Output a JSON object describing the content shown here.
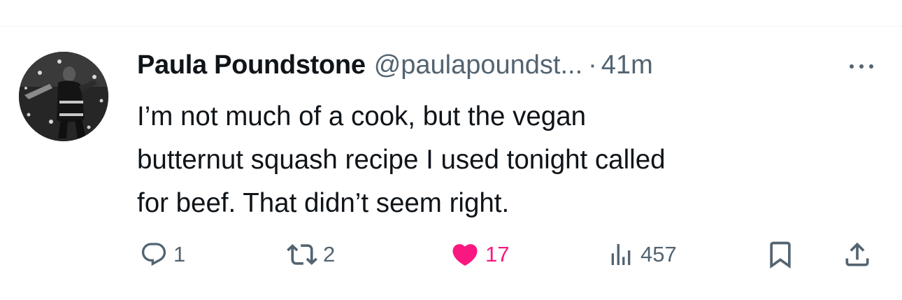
{
  "tweet": {
    "author": {
      "display_name": "Paula Poundstone",
      "handle": "@paulapoundst...",
      "separator": "·",
      "timestamp": "41m"
    },
    "text_lines": [
      "I’m not much of a cook, but the vegan",
      "butternut squash recipe I used tonight called",
      "for beef. That didn’t seem right."
    ],
    "actions": {
      "reply": {
        "icon": "reply-icon",
        "count": "1"
      },
      "retweet": {
        "icon": "retweet-icon",
        "count": "2"
      },
      "like": {
        "icon": "heart-icon",
        "count": "17",
        "liked": true,
        "color": "#f91880"
      },
      "views": {
        "icon": "views-icon",
        "count": "457"
      },
      "bookmark": {
        "icon": "bookmark-icon"
      },
      "share": {
        "icon": "share-icon"
      }
    },
    "more": {
      "icon": "more-dots-icon"
    }
  },
  "colors": {
    "text": "#0f1419",
    "secondary": "#536471",
    "like": "#f91880",
    "divider": "#eff3f4"
  }
}
